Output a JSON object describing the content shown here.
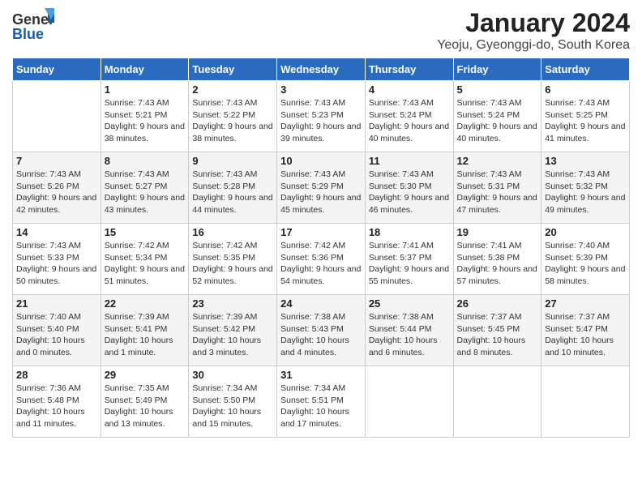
{
  "logo": {
    "line1": "General",
    "line2": "Blue"
  },
  "title": "January 2024",
  "subtitle": "Yeoju, Gyeonggi-do, South Korea",
  "days_of_week": [
    "Sunday",
    "Monday",
    "Tuesday",
    "Wednesday",
    "Thursday",
    "Friday",
    "Saturday"
  ],
  "weeks": [
    [
      {
        "day": "",
        "sunrise": "",
        "sunset": "",
        "daylight": ""
      },
      {
        "day": "1",
        "sunrise": "Sunrise: 7:43 AM",
        "sunset": "Sunset: 5:21 PM",
        "daylight": "Daylight: 9 hours and 38 minutes."
      },
      {
        "day": "2",
        "sunrise": "Sunrise: 7:43 AM",
        "sunset": "Sunset: 5:22 PM",
        "daylight": "Daylight: 9 hours and 38 minutes."
      },
      {
        "day": "3",
        "sunrise": "Sunrise: 7:43 AM",
        "sunset": "Sunset: 5:23 PM",
        "daylight": "Daylight: 9 hours and 39 minutes."
      },
      {
        "day": "4",
        "sunrise": "Sunrise: 7:43 AM",
        "sunset": "Sunset: 5:24 PM",
        "daylight": "Daylight: 9 hours and 40 minutes."
      },
      {
        "day": "5",
        "sunrise": "Sunrise: 7:43 AM",
        "sunset": "Sunset: 5:24 PM",
        "daylight": "Daylight: 9 hours and 40 minutes."
      },
      {
        "day": "6",
        "sunrise": "Sunrise: 7:43 AM",
        "sunset": "Sunset: 5:25 PM",
        "daylight": "Daylight: 9 hours and 41 minutes."
      }
    ],
    [
      {
        "day": "7",
        "sunrise": "Sunrise: 7:43 AM",
        "sunset": "Sunset: 5:26 PM",
        "daylight": "Daylight: 9 hours and 42 minutes."
      },
      {
        "day": "8",
        "sunrise": "Sunrise: 7:43 AM",
        "sunset": "Sunset: 5:27 PM",
        "daylight": "Daylight: 9 hours and 43 minutes."
      },
      {
        "day": "9",
        "sunrise": "Sunrise: 7:43 AM",
        "sunset": "Sunset: 5:28 PM",
        "daylight": "Daylight: 9 hours and 44 minutes."
      },
      {
        "day": "10",
        "sunrise": "Sunrise: 7:43 AM",
        "sunset": "Sunset: 5:29 PM",
        "daylight": "Daylight: 9 hours and 45 minutes."
      },
      {
        "day": "11",
        "sunrise": "Sunrise: 7:43 AM",
        "sunset": "Sunset: 5:30 PM",
        "daylight": "Daylight: 9 hours and 46 minutes."
      },
      {
        "day": "12",
        "sunrise": "Sunrise: 7:43 AM",
        "sunset": "Sunset: 5:31 PM",
        "daylight": "Daylight: 9 hours and 47 minutes."
      },
      {
        "day": "13",
        "sunrise": "Sunrise: 7:43 AM",
        "sunset": "Sunset: 5:32 PM",
        "daylight": "Daylight: 9 hours and 49 minutes."
      }
    ],
    [
      {
        "day": "14",
        "sunrise": "Sunrise: 7:43 AM",
        "sunset": "Sunset: 5:33 PM",
        "daylight": "Daylight: 9 hours and 50 minutes."
      },
      {
        "day": "15",
        "sunrise": "Sunrise: 7:42 AM",
        "sunset": "Sunset: 5:34 PM",
        "daylight": "Daylight: 9 hours and 51 minutes."
      },
      {
        "day": "16",
        "sunrise": "Sunrise: 7:42 AM",
        "sunset": "Sunset: 5:35 PM",
        "daylight": "Daylight: 9 hours and 52 minutes."
      },
      {
        "day": "17",
        "sunrise": "Sunrise: 7:42 AM",
        "sunset": "Sunset: 5:36 PM",
        "daylight": "Daylight: 9 hours and 54 minutes."
      },
      {
        "day": "18",
        "sunrise": "Sunrise: 7:41 AM",
        "sunset": "Sunset: 5:37 PM",
        "daylight": "Daylight: 9 hours and 55 minutes."
      },
      {
        "day": "19",
        "sunrise": "Sunrise: 7:41 AM",
        "sunset": "Sunset: 5:38 PM",
        "daylight": "Daylight: 9 hours and 57 minutes."
      },
      {
        "day": "20",
        "sunrise": "Sunrise: 7:40 AM",
        "sunset": "Sunset: 5:39 PM",
        "daylight": "Daylight: 9 hours and 58 minutes."
      }
    ],
    [
      {
        "day": "21",
        "sunrise": "Sunrise: 7:40 AM",
        "sunset": "Sunset: 5:40 PM",
        "daylight": "Daylight: 10 hours and 0 minutes."
      },
      {
        "day": "22",
        "sunrise": "Sunrise: 7:39 AM",
        "sunset": "Sunset: 5:41 PM",
        "daylight": "Daylight: 10 hours and 1 minute."
      },
      {
        "day": "23",
        "sunrise": "Sunrise: 7:39 AM",
        "sunset": "Sunset: 5:42 PM",
        "daylight": "Daylight: 10 hours and 3 minutes."
      },
      {
        "day": "24",
        "sunrise": "Sunrise: 7:38 AM",
        "sunset": "Sunset: 5:43 PM",
        "daylight": "Daylight: 10 hours and 4 minutes."
      },
      {
        "day": "25",
        "sunrise": "Sunrise: 7:38 AM",
        "sunset": "Sunset: 5:44 PM",
        "daylight": "Daylight: 10 hours and 6 minutes."
      },
      {
        "day": "26",
        "sunrise": "Sunrise: 7:37 AM",
        "sunset": "Sunset: 5:45 PM",
        "daylight": "Daylight: 10 hours and 8 minutes."
      },
      {
        "day": "27",
        "sunrise": "Sunrise: 7:37 AM",
        "sunset": "Sunset: 5:47 PM",
        "daylight": "Daylight: 10 hours and 10 minutes."
      }
    ],
    [
      {
        "day": "28",
        "sunrise": "Sunrise: 7:36 AM",
        "sunset": "Sunset: 5:48 PM",
        "daylight": "Daylight: 10 hours and 11 minutes."
      },
      {
        "day": "29",
        "sunrise": "Sunrise: 7:35 AM",
        "sunset": "Sunset: 5:49 PM",
        "daylight": "Daylight: 10 hours and 13 minutes."
      },
      {
        "day": "30",
        "sunrise": "Sunrise: 7:34 AM",
        "sunset": "Sunset: 5:50 PM",
        "daylight": "Daylight: 10 hours and 15 minutes."
      },
      {
        "day": "31",
        "sunrise": "Sunrise: 7:34 AM",
        "sunset": "Sunset: 5:51 PM",
        "daylight": "Daylight: 10 hours and 17 minutes."
      },
      {
        "day": "",
        "sunrise": "",
        "sunset": "",
        "daylight": ""
      },
      {
        "day": "",
        "sunrise": "",
        "sunset": "",
        "daylight": ""
      },
      {
        "day": "",
        "sunrise": "",
        "sunset": "",
        "daylight": ""
      }
    ]
  ]
}
